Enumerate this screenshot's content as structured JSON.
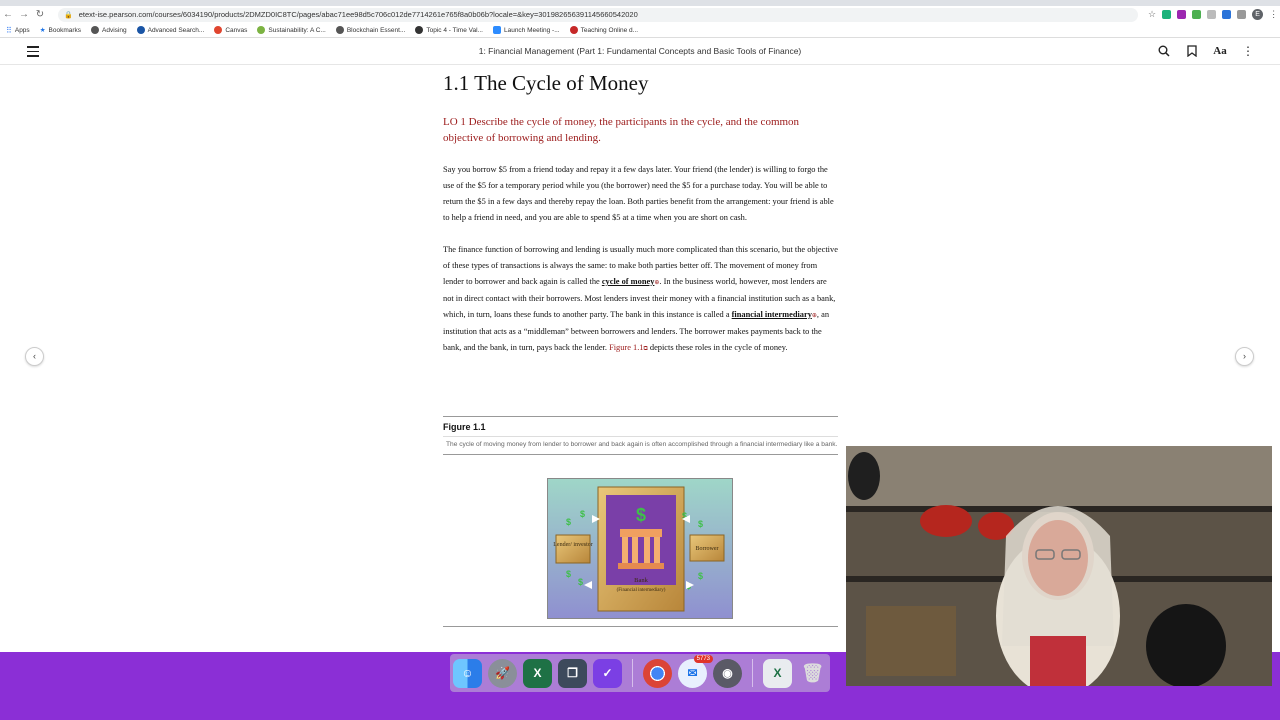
{
  "browser": {
    "url": "etext-ise.pearson.com/courses/6034190/products/2DMZD0IC8TC/pages/abac71ee98d5c706c012de7714261e765f8a0b06b?locale=&key=301982656391145660542020",
    "bookmarks": [
      "Apps",
      "Bookmarks",
      "Advising",
      "Advanced Search...",
      "Canvas",
      "Sustainability: A C...",
      "Blockchain Essent...",
      "Topic 4 - Time Val...",
      "Launch Meeting -...",
      "Teaching Online d..."
    ],
    "profile_initial": "E"
  },
  "reader": {
    "title": "1: Financial Management (Part 1: Fundamental Concepts and Basic Tools of Finance)"
  },
  "content": {
    "heading": "1.1 The Cycle of Money",
    "lo": "LO 1   Describe the cycle of money, the participants in the cycle, and the common objective of borrowing and lending.",
    "para1": "Say you borrow $5 from a friend today and repay it a few days later. Your friend (the lender) is willing to forgo the use of the $5 for a temporary period while you (the borrower) need the $5 for a purchase today. You will be able to return the $5 in a few days and thereby repay the loan. Both parties benefit from the arrangement: your friend is able to help a friend in need, and you are able to spend $5 at a time when you are short on cash.",
    "para2_a": "The finance function of borrowing and lending is usually much more complicated than this scenario, but the objective of these types of transactions is always the same: to make both parties better off. The movement of money from lender to borrower and back again is called the ",
    "term1": "cycle of money",
    "para2_b": ". In the business world, however, most lenders are not in direct contact with their borrowers. Most lenders invest their money with a financial institution such as a bank, which, in turn, loans these funds to another party. The bank in this instance is called a ",
    "term2": "financial intermediary",
    "para2_c": ", an institution that acts as a “middleman” between borrowers and lenders. The borrower makes payments back to the bank, and the bank, in turn, pays back the lender. ",
    "figref": "Figure 1.1",
    "para2_d": " depicts these roles in the cycle of money."
  },
  "figure": {
    "title": "Figure 1.1",
    "caption": "The cycle of moving money from lender to borrower and back again is often accomplished through a financial intermediary like a bank.",
    "labels": {
      "lender": "Lender/ investor",
      "borrower": "Borrower",
      "bank": "Bank",
      "bank_sub": "(Financial intermediary)"
    }
  },
  "dock": {
    "chrome_badge": "5773"
  },
  "colors": {
    "accent_red": "#9b1a1a",
    "desktop": "#8b2fd6"
  }
}
